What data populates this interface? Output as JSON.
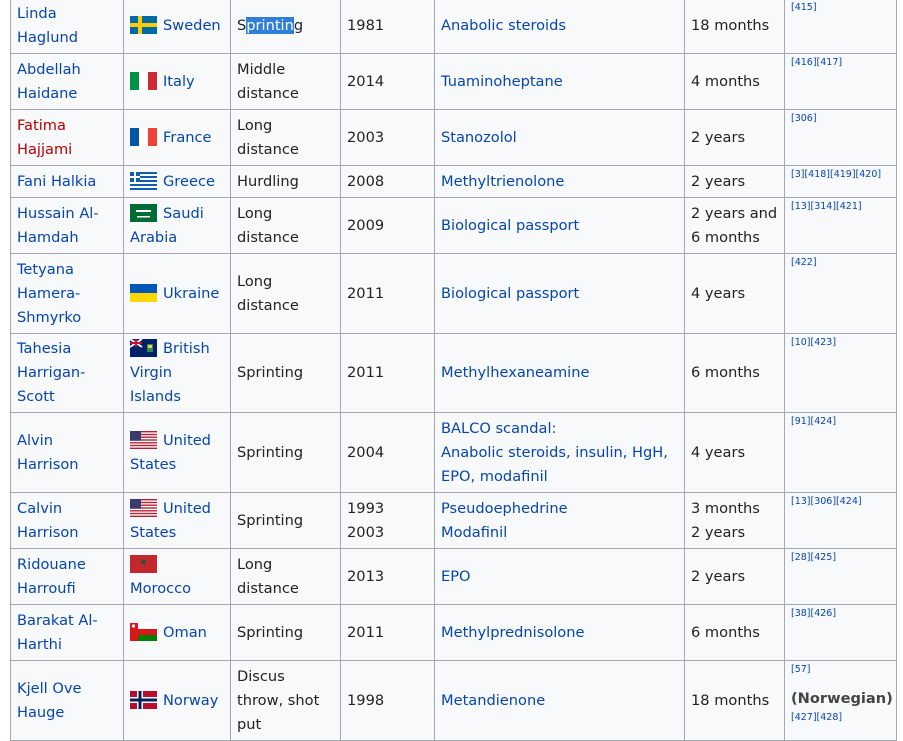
{
  "rows": [
    {
      "athlete": "Linda Haglund",
      "athlete_red": false,
      "country": "Sweden",
      "flag": "flag-sweden-icon",
      "event_parts": [
        "S",
        "printin",
        "g"
      ],
      "year": [
        "1981"
      ],
      "substance": [
        "Anabolic steroids"
      ],
      "ban": [
        "18 months"
      ],
      "refs": [
        "[415]"
      ]
    },
    {
      "athlete": "Abdellah Haidane",
      "athlete_red": false,
      "country": "Italy",
      "flag": "flag-italy-icon",
      "event": "Middle distance",
      "year": [
        "2014"
      ],
      "substance": [
        "Tuaminoheptane"
      ],
      "ban": [
        "4 months"
      ],
      "refs": [
        "[416][417]"
      ]
    },
    {
      "athlete": "Fatima Hajjami",
      "athlete_red": true,
      "country": "France",
      "flag": "flag-france-icon",
      "event": "Long distance",
      "year": [
        "2003"
      ],
      "substance": [
        "Stanozolol"
      ],
      "ban": [
        "2 years"
      ],
      "refs": [
        "[306]"
      ]
    },
    {
      "athlete": "Fani Halkia",
      "athlete_red": false,
      "country": "Greece",
      "flag": "flag-greece-icon",
      "event": "Hurdling",
      "year": [
        "2008"
      ],
      "substance": [
        "Methyltrienolone"
      ],
      "ban": [
        "2 years"
      ],
      "refs": [
        "[3][418][419][420]"
      ]
    },
    {
      "athlete": "Hussain Al-Hamdah",
      "athlete_red": false,
      "country": "Saudi Arabia",
      "flag": "flag-saudi-arabia-icon",
      "event": "Long distance",
      "year": [
        "2009"
      ],
      "substance": [
        "Biological passport"
      ],
      "ban": [
        "2 years and 6 months"
      ],
      "refs": [
        "[13][314][421]"
      ]
    },
    {
      "athlete": "Tetyana Hamera-Shmyrko",
      "athlete_red": false,
      "country": "Ukraine",
      "flag": "flag-ukraine-icon",
      "event": "Long distance",
      "year": [
        "2011"
      ],
      "substance": [
        "Biological passport"
      ],
      "ban": [
        "4 years"
      ],
      "refs": [
        "[422]"
      ]
    },
    {
      "athlete": "Tahesia Harrigan-Scott",
      "athlete_red": false,
      "country": "British Virgin Islands",
      "flag": "flag-british-virgin-islands-icon",
      "event": "Sprinting",
      "year": [
        "2011"
      ],
      "substance": [
        "Methylhexaneamine"
      ],
      "ban": [
        "6 months"
      ],
      "refs": [
        "[10][423]"
      ]
    },
    {
      "athlete": "Alvin Harrison",
      "athlete_red": false,
      "country": "United States",
      "flag": "flag-united-states-icon",
      "event": "Sprinting",
      "year": [
        "2004"
      ],
      "substance_lines": [
        "BALCO scandal:",
        "Anabolic steroids, insulin, HgH, EPO, modafinil"
      ],
      "ban": [
        "4 years"
      ],
      "refs": [
        "[91][424]"
      ]
    },
    {
      "athlete": "Calvin Harrison",
      "athlete_red": false,
      "country": "United States",
      "flag": "flag-united-states-icon",
      "event": "Sprinting",
      "year": [
        "1993",
        "2003"
      ],
      "substance": [
        "Pseudoephedrine",
        "Modafinil"
      ],
      "ban": [
        "3 months",
        "2 years"
      ],
      "refs": [
        "[13][306][424]"
      ]
    },
    {
      "athlete": "Ridouane Harroufi",
      "athlete_red": false,
      "country": "Morocco",
      "flag": "flag-morocco-icon",
      "event": "Long distance",
      "year": [
        "2013"
      ],
      "substance": [
        "EPO"
      ],
      "ban": [
        "2 years"
      ],
      "refs": [
        "[28][425]"
      ]
    },
    {
      "athlete": "Barakat Al-Harthi",
      "athlete_red": false,
      "country": "Oman",
      "flag": "flag-oman-icon",
      "event": "Sprinting",
      "year": [
        "2011"
      ],
      "substance": [
        "Methylprednisolone"
      ],
      "ban": [
        "6 months"
      ],
      "refs": [
        "[38][426]"
      ]
    },
    {
      "athlete": "Kjell Ove Hauge",
      "athlete_red": false,
      "country": "Norway",
      "flag": "flag-norway-icon",
      "event": "Discus throw, shot put",
      "year": [
        "1998"
      ],
      "substance": [
        "Metandienone"
      ],
      "ban": [
        "18 months"
      ],
      "refs": [
        "[57]"
      ],
      "ref_note": "(Norwegian)",
      "refs_after": [
        "[427][428]"
      ]
    }
  ]
}
